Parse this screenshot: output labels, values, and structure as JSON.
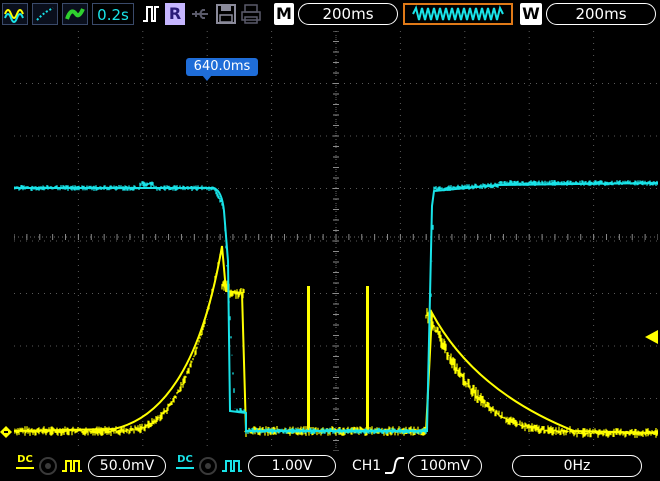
{
  "colors": {
    "ch1": "#ffff00",
    "ch2": "#19e3e8",
    "accent": "#1f6dd8",
    "window_bar": "#e07a18"
  },
  "top": {
    "waveform_icon": "sine-wave-icon",
    "sample_rate": "0.2s",
    "run_label": "R",
    "memory_label": "M",
    "memory_value": "200ms",
    "window_label": "W",
    "window_value": "200ms"
  },
  "trigger_position": "640.0ms",
  "bottom": {
    "ch1_coupling": "DC",
    "ch1_scale": "50.0mV",
    "ch2_coupling": "DC",
    "ch2_scale": "1.00V",
    "trigger_source": "CH1",
    "trigger_level": "100mV",
    "frequency": "0Hz"
  }
}
